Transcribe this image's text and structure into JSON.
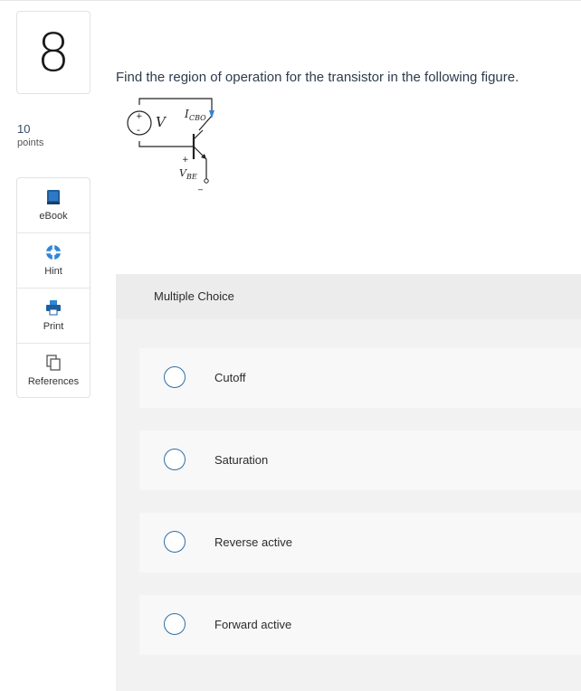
{
  "question_number": "8",
  "points": {
    "value": "10",
    "label": "points"
  },
  "tools": [
    {
      "label": "eBook",
      "icon": "book-icon"
    },
    {
      "label": "Hint",
      "icon": "lifebuoy-icon"
    },
    {
      "label": "Print",
      "icon": "printer-icon"
    },
    {
      "label": "References",
      "icon": "copy-icon"
    }
  ],
  "question_text": "Find the region of operation for the transistor in the following figure.",
  "figure": {
    "source_label": "V",
    "plus": "+",
    "minus": "-",
    "icbo_main": "I",
    "icbo_sub": "CBO",
    "vbe_main": "V",
    "vbe_sub": "BE",
    "vbe_plus": "+",
    "vbe_minus": "_"
  },
  "mc": {
    "title": "Multiple Choice",
    "choices": [
      "Cutoff",
      "Saturation",
      "Reverse active",
      "Forward active"
    ]
  },
  "colors": {
    "accent": "#2f6ea6",
    "panel": "#f2f2f2",
    "choice_bg": "#f8f8f8",
    "arrow": "#2e86d6"
  }
}
